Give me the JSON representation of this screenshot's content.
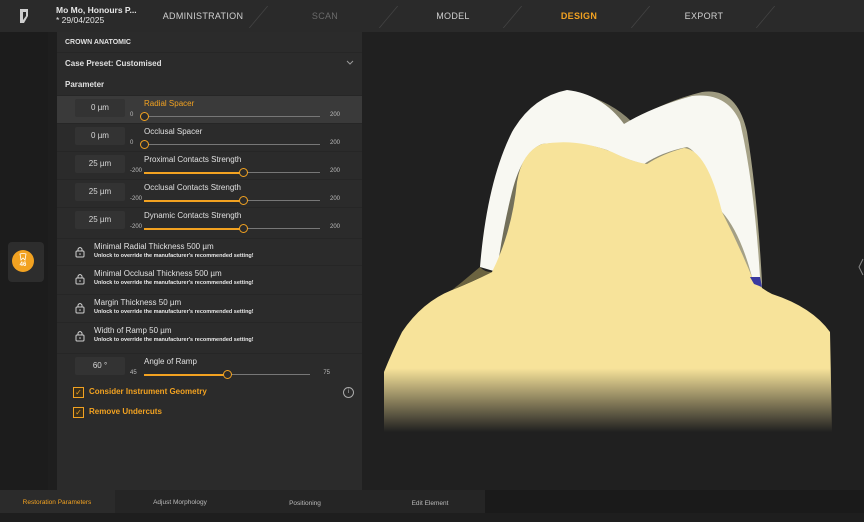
{
  "header": {
    "patient_name": "Mo Mo, Honours P...",
    "patient_date": "* 29/04/2025",
    "tabs": [
      {
        "label": "ADMINISTRATION"
      },
      {
        "label": "SCAN"
      },
      {
        "label": "MODEL"
      },
      {
        "label": "DESIGN"
      },
      {
        "label": "EXPORT"
      }
    ]
  },
  "tooth_chip": {
    "number": "46"
  },
  "panel": {
    "section_title": "CROWN ANATOMIC",
    "case_preset": "Case Preset: Customised",
    "parameter_title": "Parameter",
    "sliders": [
      {
        "value": "0 µm",
        "label": "Radial Spacer",
        "min": "0",
        "max": "200",
        "current": 0
      },
      {
        "value": "0 µm",
        "label": "Occlusal Spacer",
        "min": "0",
        "max": "200",
        "current": 0
      },
      {
        "value": "25 µm",
        "label": "Proximal Contacts Strength",
        "min": "-200",
        "max": "200",
        "current": 25
      },
      {
        "value": "25 µm",
        "label": "Occlusal Contacts Strength",
        "min": "-200",
        "max": "200",
        "current": 25
      },
      {
        "value": "25 µm",
        "label": "Dynamic Contacts Strength",
        "min": "-200",
        "max": "200",
        "current": 25
      }
    ],
    "locked": [
      {
        "name": "Minimal Radial Thickness  500 µm",
        "note": "Unlock to override the manufacturer's recommended setting!"
      },
      {
        "name": "Minimal Occlusal Thickness  500 µm",
        "note": "Unlock to override the manufacturer's recommended setting!"
      },
      {
        "name": "Margin Thickness  50 µm",
        "note": "Unlock to override the manufacturer's recommended setting!"
      },
      {
        "name": "Width of Ramp  50 µm",
        "note": "Unlock to override the manufacturer's recommended setting!"
      }
    ],
    "angle": {
      "value": "60 °",
      "label": "Angle of Ramp",
      "min": "45",
      "max": "75",
      "current": 60
    },
    "checkboxes": [
      {
        "label": "Consider Instrument Geometry",
        "checked": true
      },
      {
        "label": "Remove Undercuts",
        "checked": true
      }
    ]
  },
  "bottom_tabs": [
    {
      "label": "Restoration Parameters"
    },
    {
      "label": "Adjust Morphology"
    },
    {
      "label": "Positioning"
    },
    {
      "label": "Edit Element"
    }
  ],
  "colors": {
    "accent": "#f2a221",
    "panel": "#2b2b2b",
    "tooth_fill": "#f7e39a",
    "crown": "#f8f8f2"
  }
}
